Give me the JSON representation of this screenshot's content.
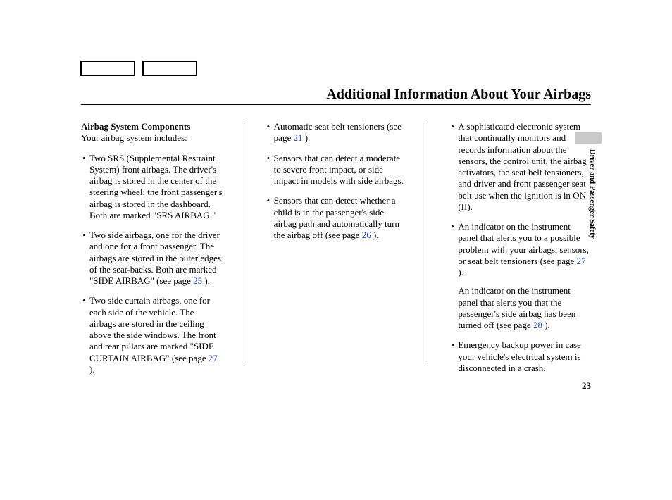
{
  "header": {
    "title": "Additional Information About Your Airbags",
    "side_label": "Driver and Passenger Safety"
  },
  "page_number": "23",
  "col1": {
    "subheading": "Airbag System Components",
    "intro": "Your airbag system includes:",
    "items": [
      {
        "text_a": "Two SRS (Supplemental Restraint System) front airbags. The driver's airbag is stored in the center of the steering wheel; the front passenger's airbag is stored in the dashboard. Both are marked \"SRS AIRBAG.\""
      },
      {
        "text_a": "Two side airbags, one for the driver and one for a front passenger. The airbags are stored in the outer edges of the seat-backs. Both are marked \"SIDE AIRBAG\" (see page ",
        "ref": "25",
        "text_b": " )."
      },
      {
        "text_a": "Two side curtain airbags, one for each side of the vehicle. The airbags are stored in the ceiling above the side windows. The front and rear pillars are marked \"SIDE CURTAIN AIRBAG\" (see page ",
        "ref": "27",
        "text_b": " )."
      }
    ]
  },
  "col2": {
    "items": [
      {
        "text_a": "Automatic seat belt tensioners (see page ",
        "ref": "21",
        "text_b": " )."
      },
      {
        "text_a": "Sensors that can detect a moderate to severe front impact, or side impact in models with side airbags."
      },
      {
        "text_a": "Sensors that can detect whether a child is in the passenger's side airbag path and automatically turn the airbag off (see page ",
        "ref": "26",
        "text_b": " )."
      }
    ]
  },
  "col3": {
    "items": [
      {
        "text_a": "A sophisticated electronic system that continually monitors and records information about the sensors, the control unit, the airbag activators, the seat belt tensioners, and driver and front passenger seat belt use when the ignition is in ON (II)."
      },
      {
        "text_a": "An indicator on the instrument panel that alerts you to a possible problem with your airbags, sensors, or seat belt tensioners (see page ",
        "ref": "27",
        "text_b": " ).",
        "follow_a": "An indicator on the instrument panel that alerts you that the passenger's side airbag has been turned off (see page ",
        "follow_ref": "28",
        "follow_b": " )."
      },
      {
        "text_a": "Emergency backup power in case your vehicle's electrical system is disconnected in a crash."
      }
    ]
  }
}
